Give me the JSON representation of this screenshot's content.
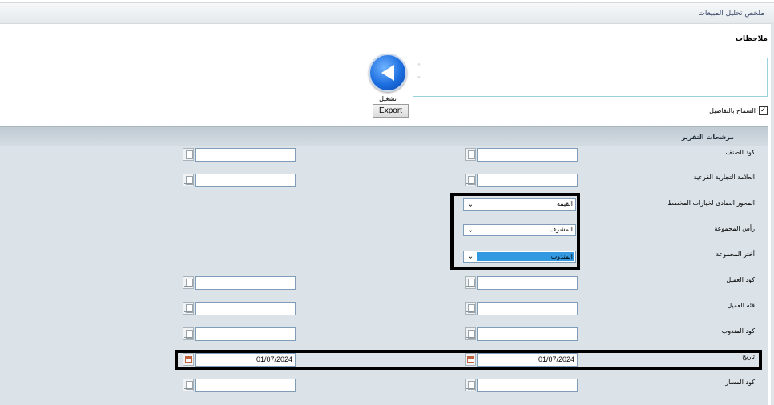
{
  "header": {
    "title": "ملخص تحليل المبيعات"
  },
  "notes": {
    "label": "ملاحظات",
    "value": ""
  },
  "actions": {
    "run_label": "تشغيل",
    "export_label": "Export"
  },
  "allow_details": {
    "label": "السماح بالتفاصيل",
    "checked": true
  },
  "filters": {
    "title": "مرشحات التقرير",
    "item_code": {
      "label": "كود الصنف",
      "from": "",
      "to": ""
    },
    "sub_brand": {
      "label": "العلامة التجارية الفرعية",
      "from": "",
      "to": ""
    },
    "chart_axis": {
      "label": "المحور الصادى لخيارات المخطط",
      "selected": "القيمة"
    },
    "group_head": {
      "label": "رأس المجموعة",
      "selected": "المشرف"
    },
    "group_by": {
      "label": "أختر المجموعة",
      "selected": "المندوب"
    },
    "customer_code": {
      "label": "كود العميل",
      "from": "",
      "to": ""
    },
    "customer_category": {
      "label": "فئه العميل",
      "from": "",
      "to": ""
    },
    "rep_code": {
      "label": "كود المندوب",
      "from": "",
      "to": ""
    },
    "date": {
      "label": "تاريخ",
      "from": "01/07/2024",
      "to": "01/07/2024"
    },
    "route_code": {
      "label": "كود المسار",
      "from": "",
      "to": ""
    }
  },
  "colors": {
    "header_bg": "#e4e9ec",
    "panel_bg": "#dce3e8",
    "select_highlight": "#3399e0"
  }
}
